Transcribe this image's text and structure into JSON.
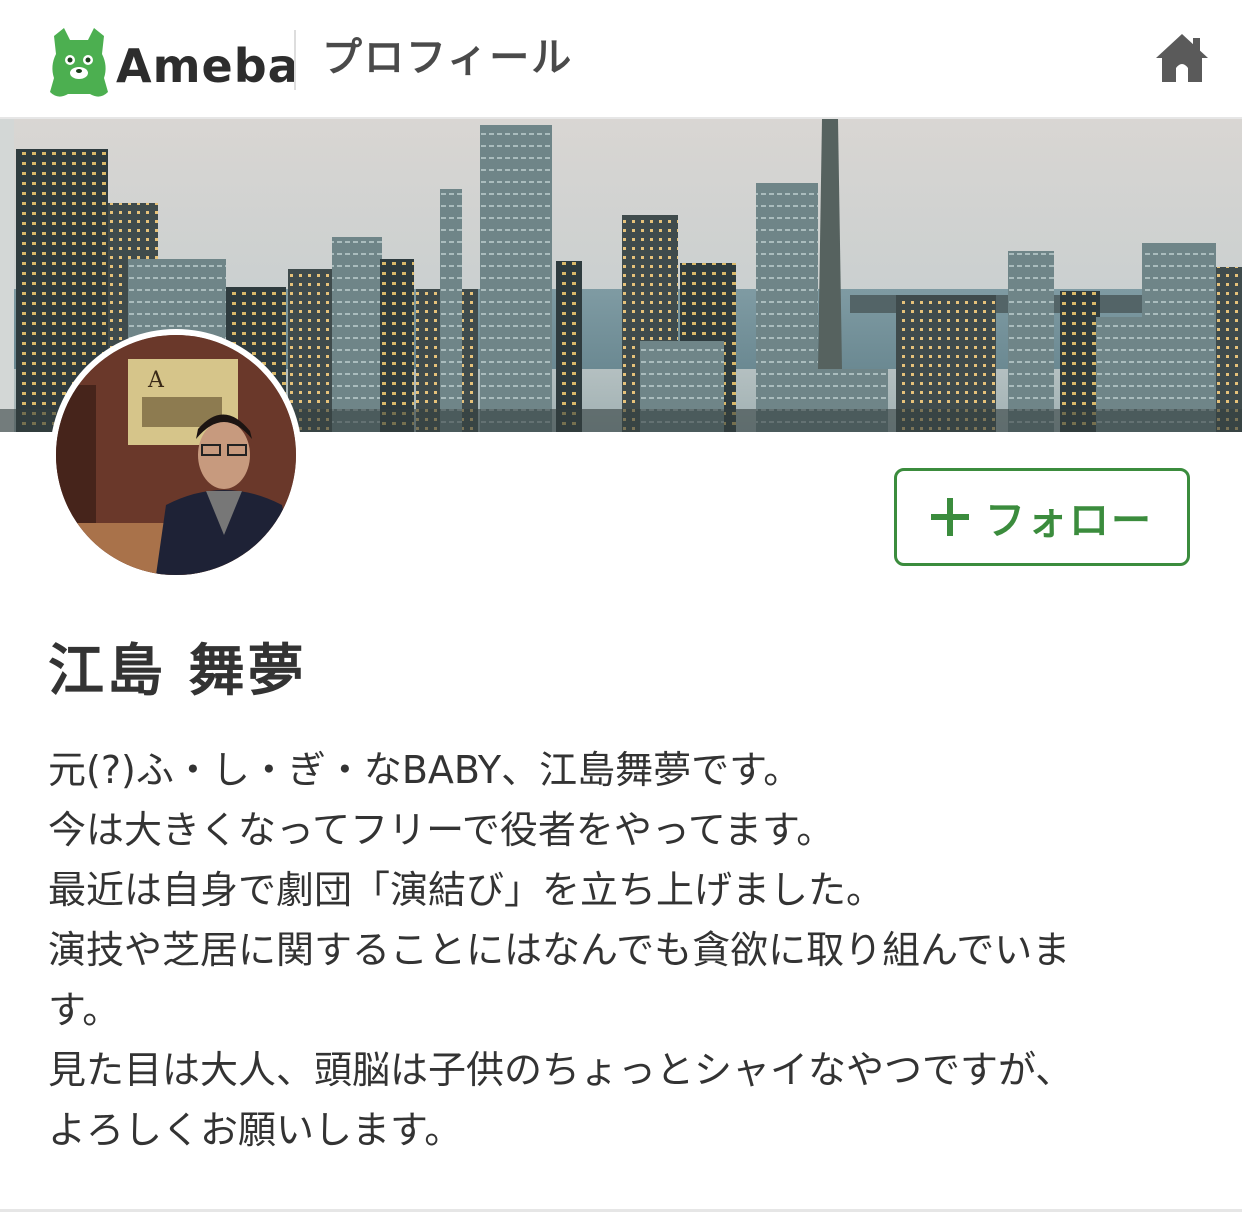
{
  "header": {
    "brand": "Ameba",
    "title": "プロフィール",
    "home_icon": "home-icon",
    "logo_icon": "ameba-logo-icon"
  },
  "cover": {
    "description_icon": "city-skyline-cover-image"
  },
  "profile": {
    "name": "江島 舞夢",
    "avatar_icon": "profile-avatar-photo",
    "follow_label": "フォロー",
    "bio_lines": [
      "元(?)ふ・し・ぎ・なBABY、江島舞夢です。",
      "今は大きくなってフリーで役者をやってます。",
      "最近は自身で劇団「演結び」を立ち上げました。",
      "演技や芝居に関することにはなんでも貪欲に取り組んでいま",
      "す。",
      "見た目は大人、頭脳は子供のちょっとシャイなやつですが、",
      "よろしくお願いします。"
    ]
  },
  "colors": {
    "accent_green": "#3b8c3d",
    "text_dark": "#333333",
    "logo_green": "#4caf50"
  }
}
